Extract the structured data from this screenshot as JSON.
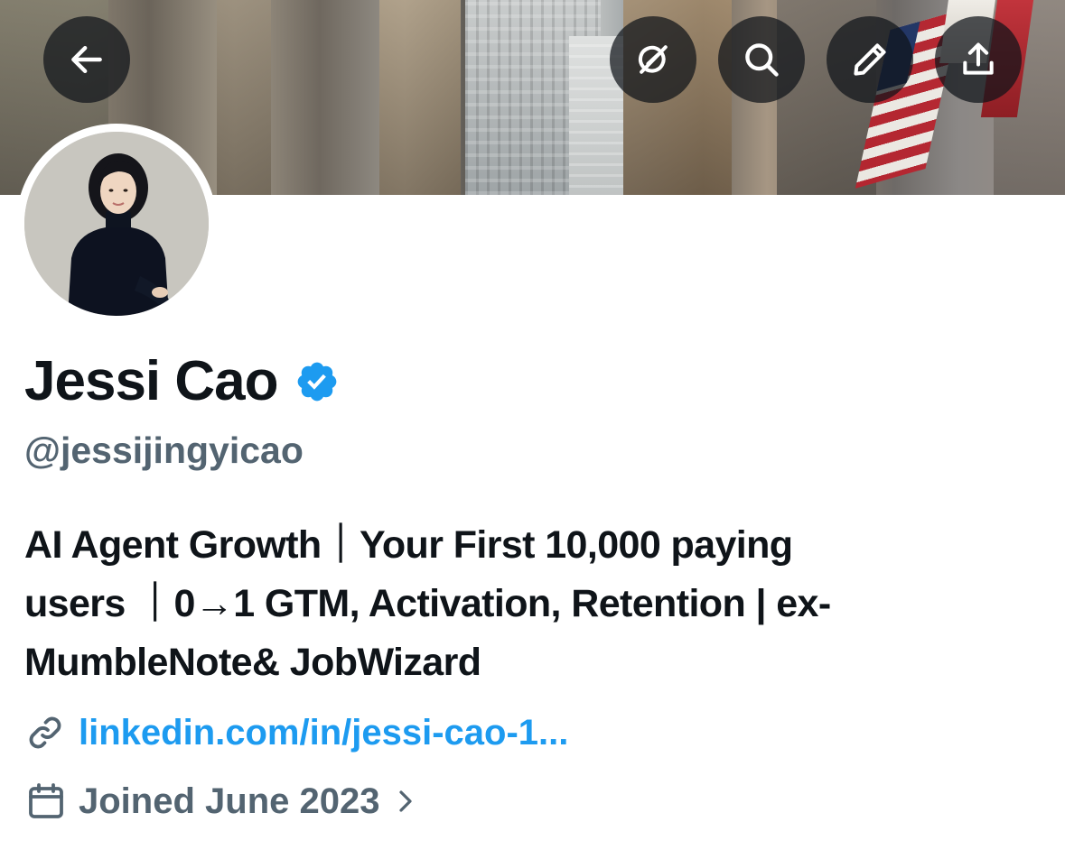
{
  "header": {
    "toolbar": {
      "back_icon": "arrow-left-icon",
      "grok_icon": "grok-icon",
      "search_icon": "search-icon",
      "edit_icon": "pencil-icon",
      "share_icon": "share-upload-icon"
    }
  },
  "profile": {
    "display_name": "Jessi Cao",
    "verified": true,
    "verified_color": "#1d9bf0",
    "handle": "@jessijingyicao",
    "bio_lines": [
      "AI Agent Growth｜Your First 10,000 paying",
      "users ｜0→1 GTM, Activation, Retention | ex-",
      "MumbleNote& JobWizard"
    ],
    "link": {
      "icon": "link-icon",
      "text": "linkedin.com/in/jessi-cao-1..."
    },
    "joined": {
      "icon": "calendar-icon",
      "text": "Joined June 2023",
      "chevron": "chevron-right-icon"
    }
  },
  "colors": {
    "text_primary": "#0f1419",
    "text_secondary": "#536471",
    "accent": "#1d9bf0",
    "button_overlay": "rgba(15,20,25,0.72)"
  }
}
